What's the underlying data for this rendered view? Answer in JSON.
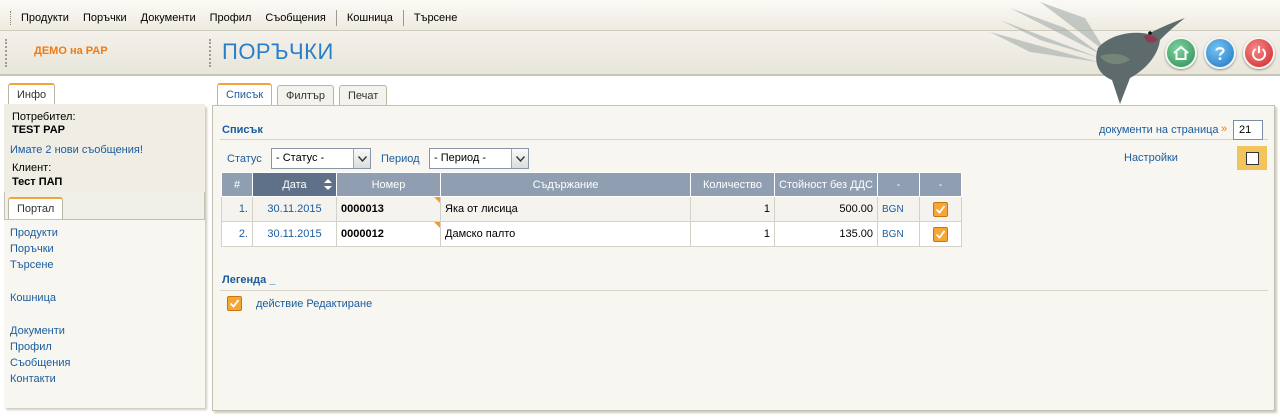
{
  "menu": {
    "items": [
      "Продукти",
      "Поръчки",
      "Документи",
      "Профил",
      "Съобщения"
    ],
    "cart": "Кошница",
    "search": "Търсене"
  },
  "header": {
    "company": "ДЕМО на PAP",
    "title": "ПОРЪЧКИ",
    "buttons": [
      "home-icon",
      "help-icon",
      "power-icon"
    ],
    "colors": {
      "home": "#3fa56a",
      "help": "#2b8fd6",
      "power": "#e0383a",
      "title": "#2a7fc9",
      "company": "#f07a13"
    }
  },
  "sidebar": {
    "info_tab": "Инфо",
    "user_label": "Потребител:",
    "user_value": "TEST PAP",
    "messages": "Имате 2 нови съобщения!",
    "client_label": "Клиент:",
    "client_value": "Тест ПАП",
    "portal_tab": "Портал",
    "links": [
      "Продукти",
      "Поръчки",
      "Търсене",
      "Кошница",
      "Документи",
      "Профил",
      "Съобщения",
      "Контакти"
    ]
  },
  "tabs": [
    "Списък",
    "Филтър",
    "Печат"
  ],
  "list": {
    "title": "Списък",
    "per_page_label": "документи на страница",
    "per_page_arrow": "»",
    "per_page_value": "21",
    "status_label": "Статус",
    "status_value": "- Статус -",
    "period_label": "Период",
    "period_value": "- Период -",
    "settings_label": "Настройки"
  },
  "table": {
    "headers": [
      "#",
      "Дата",
      "Номер",
      "Съдържание",
      "Количество",
      "Стойност без ДДС",
      "-",
      "-"
    ],
    "rows": [
      {
        "num": "1.",
        "date": "30.11.2015",
        "number": "0000013",
        "desc": "Яка от лисица",
        "qty": "1",
        "price": "500.00",
        "currency": "BGN"
      },
      {
        "num": "2.",
        "date": "30.11.2015",
        "number": "0000012",
        "desc": "Дамско палто",
        "qty": "1",
        "price": "135.00",
        "currency": "BGN"
      }
    ]
  },
  "legend": {
    "title": "Легенда _",
    "action": "действие Редактиране"
  }
}
